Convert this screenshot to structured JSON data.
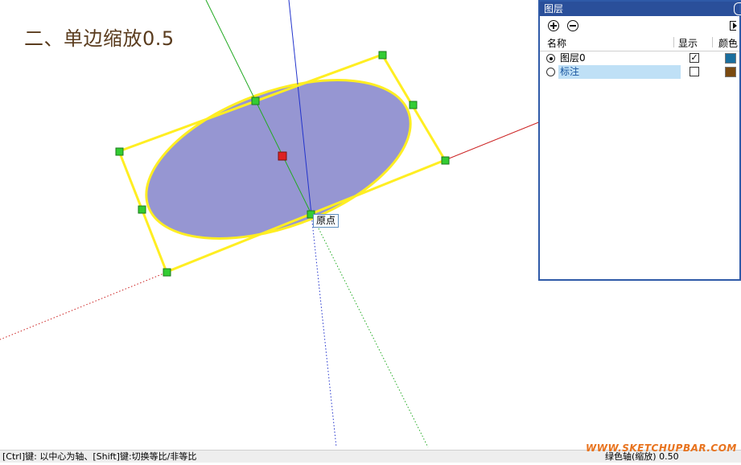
{
  "canvas": {
    "heading": "二、单边缩放0.5",
    "origin_tooltip": "原点",
    "colors": {
      "background": "#ffffff",
      "ellipse_fill": "#9696d2",
      "selection_yellow": "#ffee22",
      "grip_green": "#33cc33",
      "center_red": "#dd2222",
      "axis_red": "#cc2222",
      "axis_green": "#22aa22",
      "axis_blue": "#2233cc"
    }
  },
  "layers_panel": {
    "title": "图层",
    "icons": {
      "add": "add-layer-icon",
      "remove": "remove-layer-icon",
      "details": "details-icon"
    },
    "columns": {
      "name": "名称",
      "visible": "显示",
      "color": "颜色"
    },
    "rows": [
      {
        "name": "图层0",
        "active": true,
        "visible": true,
        "color": "#1a6e9e"
      },
      {
        "name": "标注",
        "active": false,
        "visible": false,
        "color": "#7a4a10"
      }
    ]
  },
  "statusbar": {
    "hint": "[Ctrl]键: 以中心为轴、[Shift]键:切换等比/非等比",
    "measurement": "绿色轴(缩放) 0.50"
  },
  "watermark": "WWW.SKETCHUPBAR.COM"
}
